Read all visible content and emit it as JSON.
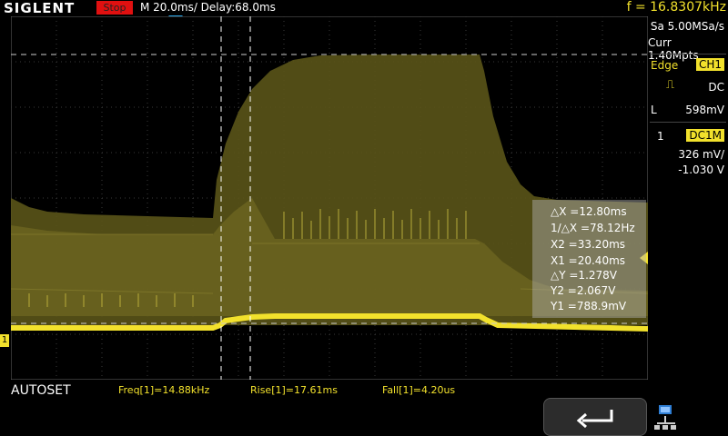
{
  "header": {
    "logo": "SIGLENT",
    "run_state": "Stop",
    "timebase": "M 20.0ms/ Delay:68.0ms",
    "frequency": "f = 16.8307kHz"
  },
  "right_panel": {
    "sample_rate": "Sa 5.00MSa/s",
    "memory": "Curr 1.40Mpts",
    "trigger_type": "Edge",
    "trigger_source": "CH1",
    "coupling": "DC",
    "level_label": "L",
    "level_value": "598mV",
    "channel_number": "1",
    "channel_mode": "DC1M",
    "volts_div": "326 mV/",
    "offset": "-1.030 V"
  },
  "cursor_panel": {
    "dx": "△X =12.80ms",
    "inv_dx": "1/△X =78.12Hz",
    "x2": "X2 =33.20ms",
    "x1": "X1 =20.40ms",
    "dy": "△Y =1.278V",
    "y2": "Y2 =2.067V",
    "y1": "Y1 =788.9mV"
  },
  "bottom": {
    "autoset": "AUTOSET",
    "meas_freq": "Freq[1]=14.88kHz",
    "meas_rise": "Rise[1]=17.61ms",
    "meas_fall": "Fall[1]=4.20us"
  },
  "channel_marker": "1",
  "colors": {
    "trace": "#f2e12c",
    "stop": "#e01010",
    "trigger_marker": "#29a6e8",
    "grid": "#3a3a3a"
  }
}
